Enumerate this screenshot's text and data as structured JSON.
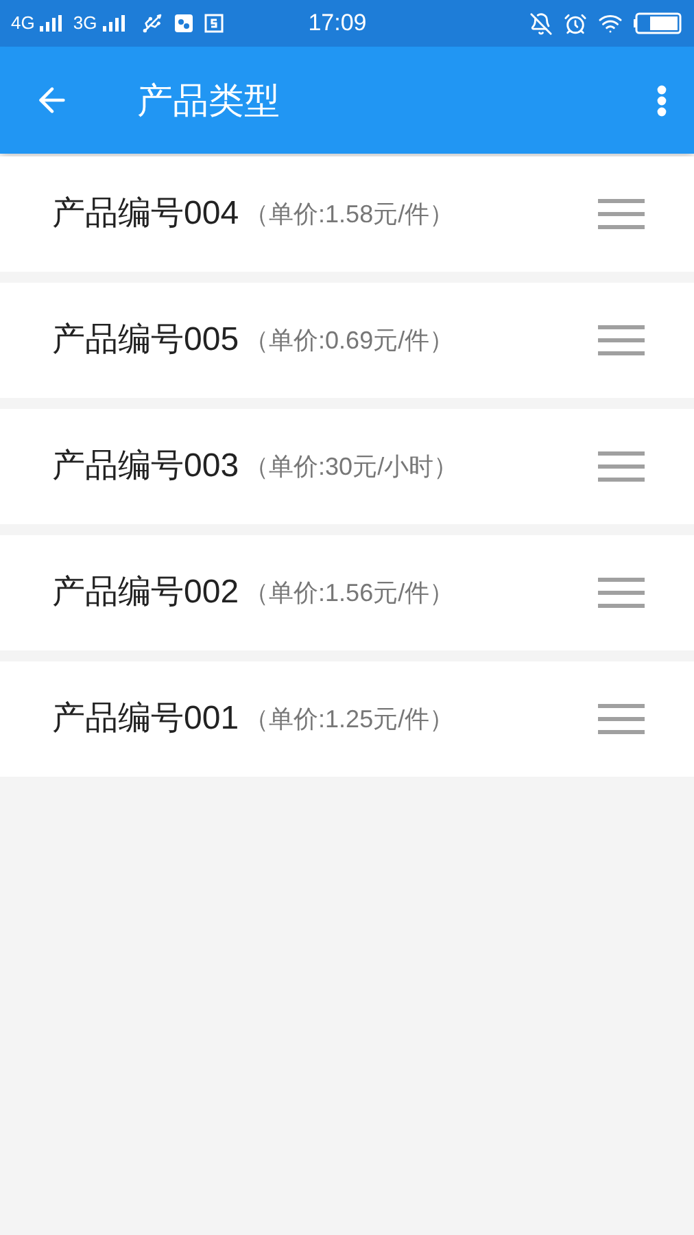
{
  "status_bar": {
    "network_1": "4G",
    "network_2": "3G",
    "time": "17:09"
  },
  "app_bar": {
    "title": "产品类型"
  },
  "products": [
    {
      "name": "产品编号004",
      "price": "（单价:1.58元/件）"
    },
    {
      "name": "产品编号005",
      "price": "（单价:0.69元/件）"
    },
    {
      "name": "产品编号003",
      "price": "（单价:30元/小时）"
    },
    {
      "name": "产品编号002",
      "price": "（单价:1.56元/件）"
    },
    {
      "name": "产品编号001",
      "price": "（单价:1.25元/件）"
    }
  ]
}
